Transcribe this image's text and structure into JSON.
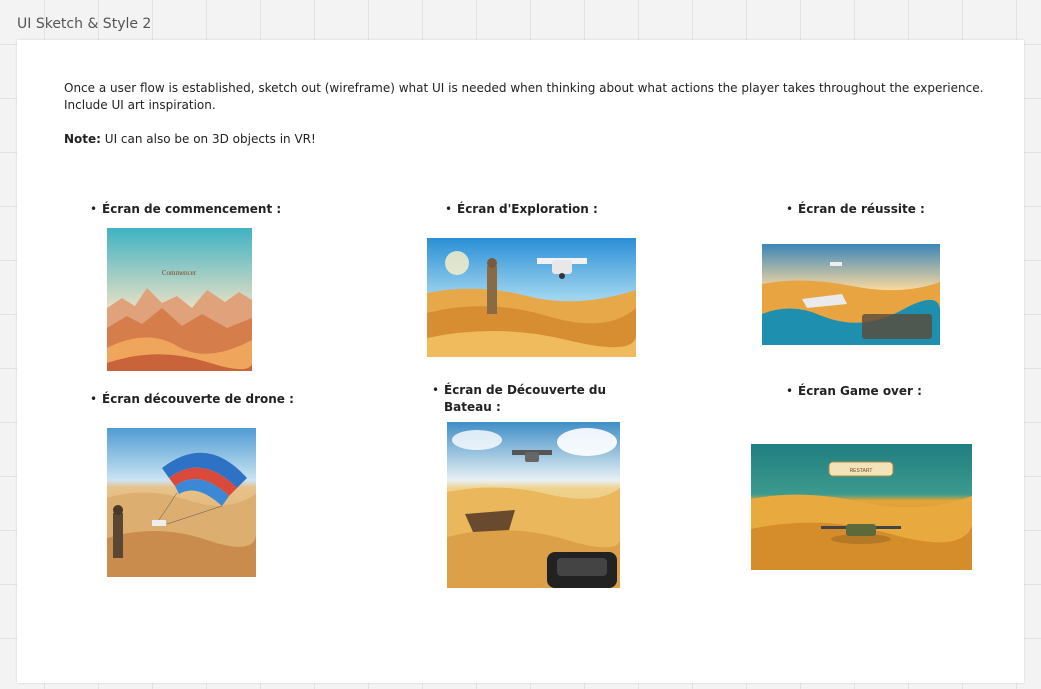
{
  "frame": {
    "title": "UI Sketch & Style 2"
  },
  "intro": {
    "text": "Once a user flow is established, sketch out (wireframe) what UI is needed when thinking about what actions the player takes throughout the experience. Include UI art inspiration.",
    "note_label": "Note:",
    "note_text": " UI can also be on 3D objects in VR!"
  },
  "screens": [
    {
      "heading": "Écran de commencement :",
      "image_text": "Commencer"
    },
    {
      "heading": "Écran d'Exploration :"
    },
    {
      "heading": "Écran de réussite :"
    },
    {
      "heading": "Écran découverte de drone :"
    },
    {
      "heading": "Écran de Découverte du Bateau :"
    },
    {
      "heading": "Écran Game over :",
      "image_text": "RESTART"
    }
  ],
  "bullet": "•",
  "colors": {
    "sand": "#e9a33a",
    "sky": "#5fb9d6",
    "teal": "#1f7e80"
  }
}
